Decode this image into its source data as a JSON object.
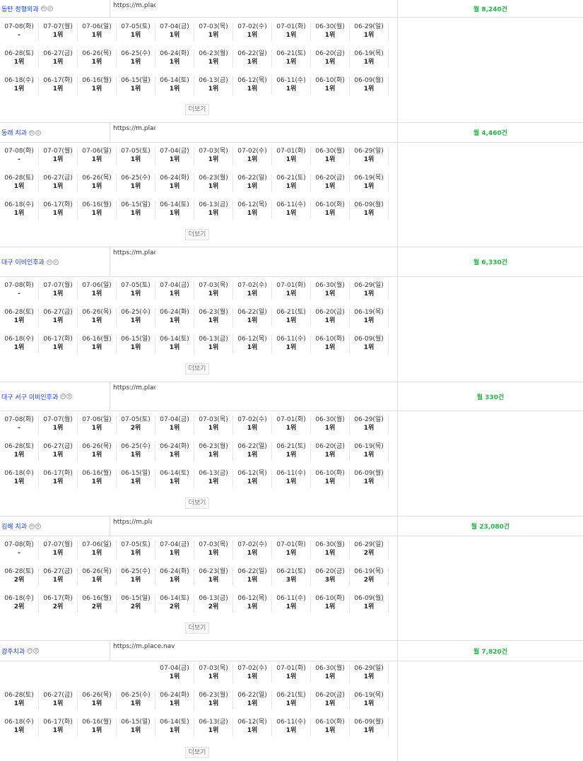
{
  "more_label": "더보기",
  "volume_color": "#2bb24c",
  "link_color": "#1a3fd0",
  "blocks": [
    {
      "keyword": "동탄 정형외과",
      "url": "https://m.plac",
      "volume": "월 8,240건",
      "rows": [
        [
          [
            "07-08(화)",
            "-"
          ],
          [
            "07-07(월)",
            "1위"
          ],
          [
            "07-06(일)",
            "1위"
          ],
          [
            "07-05(토)",
            "1위"
          ],
          [
            "07-04(금)",
            "1위"
          ],
          [
            "07-03(목)",
            "1위"
          ],
          [
            "07-02(수)",
            "1위"
          ],
          [
            "07-01(화)",
            "1위"
          ],
          [
            "06-30(월)",
            "1위"
          ],
          [
            "06-29(일)",
            "1위"
          ]
        ],
        [
          [
            "06-28(토)",
            "1위"
          ],
          [
            "06-27(금)",
            "1위"
          ],
          [
            "06-26(목)",
            "1위"
          ],
          [
            "06-25(수)",
            "1위"
          ],
          [
            "06-24(화)",
            "1위"
          ],
          [
            "06-23(월)",
            "1위"
          ],
          [
            "06-22(일)",
            "1위"
          ],
          [
            "06-21(토)",
            "1위"
          ],
          [
            "06-20(금)",
            "1위"
          ],
          [
            "06-19(목)",
            "1위"
          ]
        ],
        [
          [
            "06-18(수)",
            "1위"
          ],
          [
            "06-17(화)",
            "1위"
          ],
          [
            "06-16(월)",
            "1위"
          ],
          [
            "06-15(일)",
            "1위"
          ],
          [
            "06-14(토)",
            "1위"
          ],
          [
            "06-13(금)",
            "1위"
          ],
          [
            "06-12(목)",
            "1위"
          ],
          [
            "06-11(수)",
            "1위"
          ],
          [
            "06-10(화)",
            "1위"
          ],
          [
            "06-09(월)",
            "1위"
          ]
        ]
      ]
    },
    {
      "keyword": "동래 치과",
      "url": "https://m.plac",
      "volume": "월 4,460건",
      "rows": [
        [
          [
            "07-08(화)",
            "-"
          ],
          [
            "07-07(월)",
            "1위"
          ],
          [
            "07-06(일)",
            "1위"
          ],
          [
            "07-05(토)",
            "1위"
          ],
          [
            "07-04(금)",
            "1위"
          ],
          [
            "07-03(목)",
            "1위"
          ],
          [
            "07-02(수)",
            "1위"
          ],
          [
            "07-01(화)",
            "1위"
          ],
          [
            "06-30(월)",
            "1위"
          ],
          [
            "06-29(일)",
            "1위"
          ]
        ],
        [
          [
            "06-28(토)",
            "1위"
          ],
          [
            "06-27(금)",
            "1위"
          ],
          [
            "06-26(목)",
            "1위"
          ],
          [
            "06-25(수)",
            "1위"
          ],
          [
            "06-24(화)",
            "1위"
          ],
          [
            "06-23(월)",
            "1위"
          ],
          [
            "06-22(일)",
            "1위"
          ],
          [
            "06-21(토)",
            "1위"
          ],
          [
            "06-20(금)",
            "1위"
          ],
          [
            "06-19(목)",
            "1위"
          ]
        ],
        [
          [
            "06-18(수)",
            "1위"
          ],
          [
            "06-17(화)",
            "1위"
          ],
          [
            "06-16(월)",
            "1위"
          ],
          [
            "06-15(일)",
            "1위"
          ],
          [
            "06-14(토)",
            "1위"
          ],
          [
            "06-13(금)",
            "1위"
          ],
          [
            "06-12(목)",
            "1위"
          ],
          [
            "06-11(수)",
            "1위"
          ],
          [
            "06-10(화)",
            "1위"
          ],
          [
            "06-09(월)",
            "1위"
          ]
        ]
      ]
    },
    {
      "keyword": "대구 이비인후과",
      "url": "https://m.plac",
      "volume": "월 6,330건",
      "rows": [
        [
          [
            "07-08(화)",
            "-"
          ],
          [
            "07-07(월)",
            "1위"
          ],
          [
            "07-06(일)",
            "1위"
          ],
          [
            "07-05(토)",
            "1위"
          ],
          [
            "07-04(금)",
            "1위"
          ],
          [
            "07-03(목)",
            "1위"
          ],
          [
            "07-02(수)",
            "1위"
          ],
          [
            "07-01(화)",
            "1위"
          ],
          [
            "06-30(월)",
            "1위"
          ],
          [
            "06-29(일)",
            "1위"
          ]
        ],
        [
          [
            "06-28(토)",
            "1위"
          ],
          [
            "06-27(금)",
            "1위"
          ],
          [
            "06-26(목)",
            "1위"
          ],
          [
            "06-25(수)",
            "1위"
          ],
          [
            "06-24(화)",
            "1위"
          ],
          [
            "06-23(월)",
            "1위"
          ],
          [
            "06-22(일)",
            "1위"
          ],
          [
            "06-21(토)",
            "1위"
          ],
          [
            "06-20(금)",
            "1위"
          ],
          [
            "06-19(목)",
            "1위"
          ]
        ],
        [
          [
            "06-18(수)",
            "1위"
          ],
          [
            "06-17(화)",
            "1위"
          ],
          [
            "06-16(월)",
            "1위"
          ],
          [
            "06-15(일)",
            "1위"
          ],
          [
            "06-14(토)",
            "1위"
          ],
          [
            "06-13(금)",
            "1위"
          ],
          [
            "06-12(목)",
            "1위"
          ],
          [
            "06-11(수)",
            "1위"
          ],
          [
            "06-10(화)",
            "1위"
          ],
          [
            "06-09(월)",
            "1위"
          ]
        ]
      ]
    },
    {
      "keyword": "대구 서구 이비인후과",
      "url": "https://m.place.r",
      "volume": "월 330건",
      "rows": [
        [
          [
            "07-08(화)",
            "-"
          ],
          [
            "07-07(월)",
            "1위"
          ],
          [
            "07-06(일)",
            "1위"
          ],
          [
            "07-05(토)",
            "2위"
          ],
          [
            "07-04(금)",
            "1위"
          ],
          [
            "07-03(목)",
            "1위"
          ],
          [
            "07-02(수)",
            "1위"
          ],
          [
            "07-01(화)",
            "1위"
          ],
          [
            "06-30(월)",
            "1위"
          ],
          [
            "06-29(일)",
            "1위"
          ]
        ],
        [
          [
            "06-28(토)",
            "1위"
          ],
          [
            "06-27(금)",
            "1위"
          ],
          [
            "06-26(목)",
            "1위"
          ],
          [
            "06-25(수)",
            "1위"
          ],
          [
            "06-24(화)",
            "1위"
          ],
          [
            "06-23(월)",
            "1위"
          ],
          [
            "06-22(일)",
            "1위"
          ],
          [
            "06-21(토)",
            "1위"
          ],
          [
            "06-20(금)",
            "1위"
          ],
          [
            "06-19(목)",
            "1위"
          ]
        ],
        [
          [
            "06-18(수)",
            "1위"
          ],
          [
            "06-17(화)",
            "1위"
          ],
          [
            "06-16(월)",
            "1위"
          ],
          [
            "06-15(일)",
            "1위"
          ],
          [
            "06-14(토)",
            "1위"
          ],
          [
            "06-13(금)",
            "1위"
          ],
          [
            "06-12(목)",
            "1위"
          ],
          [
            "06-11(수)",
            "1위"
          ],
          [
            "06-10(화)",
            "1위"
          ],
          [
            "06-09(월)",
            "1위"
          ]
        ]
      ]
    },
    {
      "keyword": "김해 치과",
      "url": "https://m.pla",
      "volume": "월 23,080건",
      "rows": [
        [
          [
            "07-08(화)",
            "-"
          ],
          [
            "07-07(월)",
            "1위"
          ],
          [
            "07-06(일)",
            "1위"
          ],
          [
            "07-05(토)",
            "1위"
          ],
          [
            "07-04(금)",
            "1위"
          ],
          [
            "07-03(목)",
            "1위"
          ],
          [
            "07-02(수)",
            "1위"
          ],
          [
            "07-01(화)",
            "1위"
          ],
          [
            "06-30(월)",
            "1위"
          ],
          [
            "06-29(일)",
            "2위"
          ]
        ],
        [
          [
            "06-28(토)",
            "2위"
          ],
          [
            "06-27(금)",
            "1위"
          ],
          [
            "06-26(목)",
            "1위"
          ],
          [
            "06-25(수)",
            "1위"
          ],
          [
            "06-24(화)",
            "1위"
          ],
          [
            "06-23(월)",
            "1위"
          ],
          [
            "06-22(일)",
            "1위"
          ],
          [
            "06-21(토)",
            "3위"
          ],
          [
            "06-20(금)",
            "3위"
          ],
          [
            "06-19(목)",
            "2위"
          ]
        ],
        [
          [
            "06-18(수)",
            "2위"
          ],
          [
            "06-17(화)",
            "2위"
          ],
          [
            "06-16(월)",
            "2위"
          ],
          [
            "06-15(일)",
            "2위"
          ],
          [
            "06-14(토)",
            "2위"
          ],
          [
            "06-13(금)",
            "2위"
          ],
          [
            "06-12(목)",
            "1위"
          ],
          [
            "06-11(수)",
            "1위"
          ],
          [
            "06-10(화)",
            "1위"
          ],
          [
            "06-09(월)",
            "1위"
          ]
        ]
      ]
    },
    {
      "keyword": "광주치과",
      "url": "https://m.place.nave",
      "volume": "월 7,820건",
      "rows": [
        [
          null,
          null,
          null,
          null,
          [
            "07-04(금)",
            "1위"
          ],
          [
            "07-03(목)",
            "1위"
          ],
          [
            "07-02(수)",
            "1위"
          ],
          [
            "07-01(화)",
            "1위"
          ],
          [
            "06-30(월)",
            "1위"
          ],
          [
            "06-29(일)",
            "1위"
          ]
        ],
        [
          [
            "06-28(토)",
            "1위"
          ],
          [
            "06-27(금)",
            "1위"
          ],
          [
            "06-26(목)",
            "1위"
          ],
          [
            "06-25(수)",
            "1위"
          ],
          [
            "06-24(화)",
            "1위"
          ],
          [
            "06-23(월)",
            "1위"
          ],
          [
            "06-22(일)",
            "1위"
          ],
          [
            "06-21(토)",
            "1위"
          ],
          [
            "06-20(금)",
            "1위"
          ],
          [
            "06-19(목)",
            "1위"
          ]
        ],
        [
          [
            "06-18(수)",
            "1위"
          ],
          [
            "06-17(화)",
            "1위"
          ],
          [
            "06-16(월)",
            "1위"
          ],
          [
            "06-15(일)",
            "1위"
          ],
          [
            "06-14(토)",
            "1위"
          ],
          [
            "06-13(금)",
            "1위"
          ],
          [
            "06-12(목)",
            "1위"
          ],
          [
            "06-11(수)",
            "1위"
          ],
          [
            "06-10(화)",
            "1위"
          ],
          [
            "06-09(월)",
            "1위"
          ]
        ]
      ]
    }
  ]
}
